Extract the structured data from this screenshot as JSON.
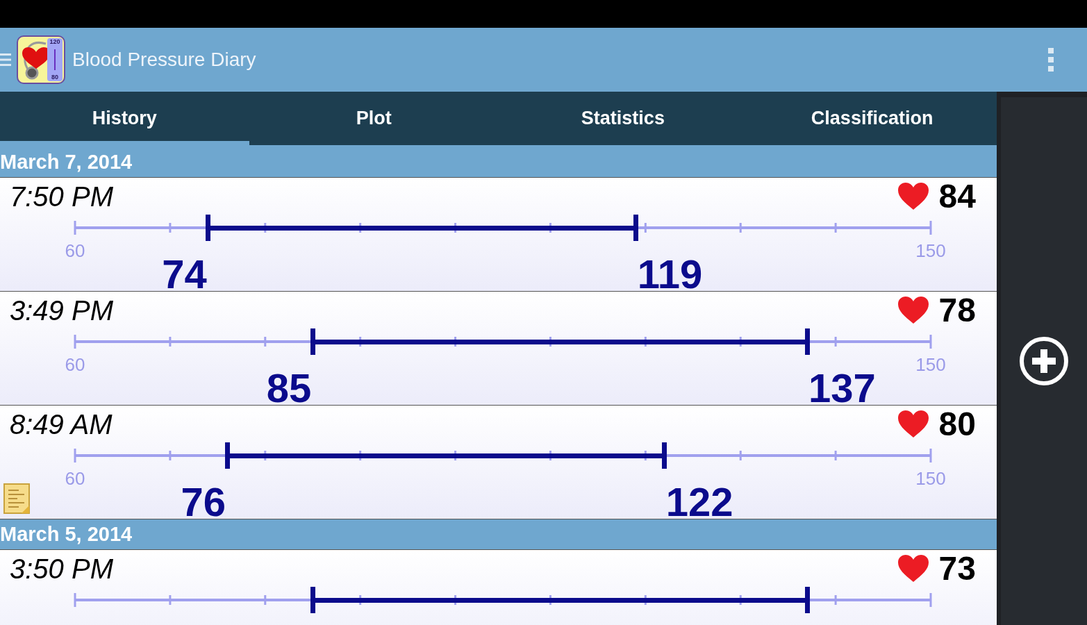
{
  "app_bar": {
    "title": "Blood Pressure Diary",
    "icon_labels": [
      "120",
      "80"
    ]
  },
  "tabs": [
    {
      "label": "History",
      "selected": true
    },
    {
      "label": "Plot",
      "selected": false
    },
    {
      "label": "Statistics",
      "selected": false
    },
    {
      "label": "Classification",
      "selected": false
    }
  ],
  "history": [
    {
      "kind": "date",
      "label": "March 7, 2014"
    },
    {
      "kind": "entry",
      "time": "7:50 PM",
      "pulse": "84",
      "scale_min": "60",
      "scale_max": "150",
      "diastolic": "74",
      "systolic": "119",
      "low": {
        "level": 0.1556
      },
      "high": {
        "level": 0.6556
      },
      "note": false
    },
    {
      "kind": "entry",
      "time": "3:49 PM",
      "pulse": "78",
      "scale_min": "60",
      "scale_max": "150",
      "diastolic": "85",
      "systolic": "137",
      "low": {
        "level": 0.2778
      },
      "high": {
        "level": 0.8556
      },
      "note": false
    },
    {
      "kind": "entry",
      "time": "8:49 AM",
      "pulse": "80",
      "scale_min": "60",
      "scale_max": "150",
      "diastolic": "76",
      "systolic": "122",
      "low": {
        "level": 0.1778
      },
      "high": {
        "level": 0.6889
      },
      "note": true
    },
    {
      "kind": "date",
      "label": "March 5, 2014"
    },
    {
      "kind": "entry",
      "time": "3:50 PM",
      "pulse": "73",
      "low": {
        "level": 0.2778
      },
      "high": {
        "level": 0.8556
      },
      "note": false
    }
  ]
}
